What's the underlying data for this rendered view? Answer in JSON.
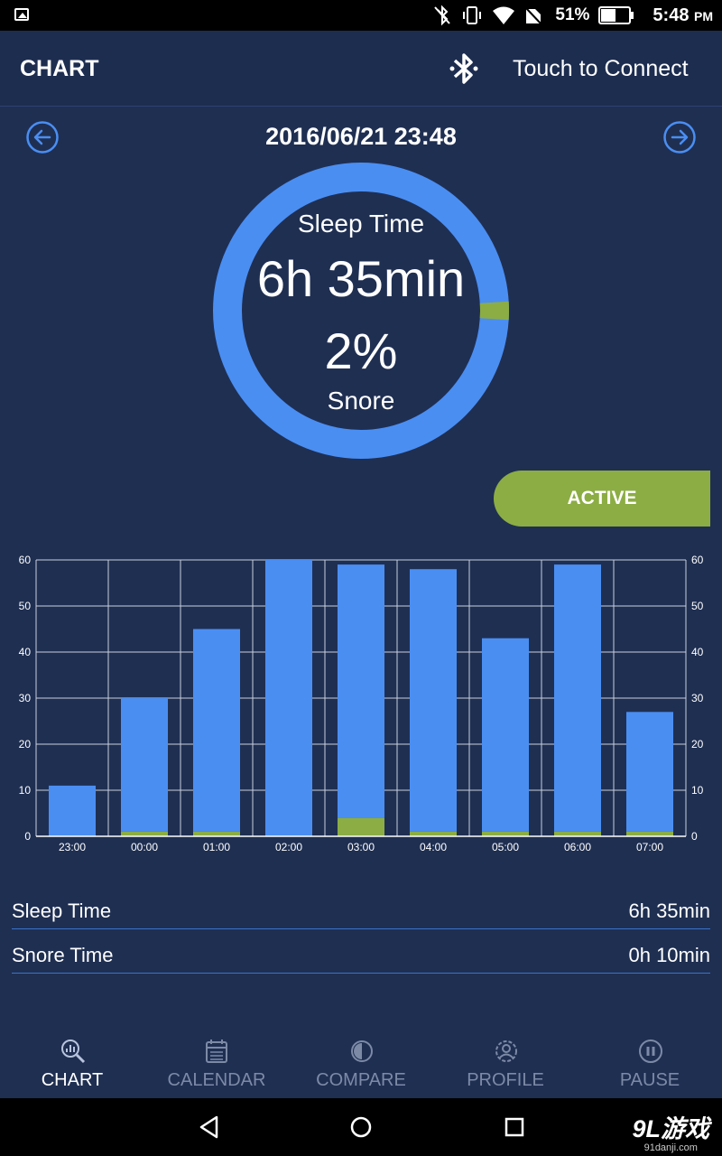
{
  "status_bar": {
    "battery_percent": "51%",
    "time": "5:48",
    "time_suffix": "PM",
    "icons": [
      "gallery-icon",
      "bluetooth-off-icon",
      "vibrate-icon",
      "wifi-icon",
      "no-sim-icon",
      "battery-icon"
    ]
  },
  "header": {
    "title": "CHART",
    "connect_label": "Touch to Connect",
    "icon": "bluetooth-icon"
  },
  "date_nav": {
    "date": "2016/06/21 23:48",
    "prev_icon": "arrow-left-circle-icon",
    "next_icon": "arrow-right-circle-icon"
  },
  "donut": {
    "label_top": "Sleep Time",
    "duration": "6h 35min",
    "snore_percent_label": "2%",
    "label_bottom": "Snore",
    "snore_fraction": 0.02,
    "colors": {
      "sleep": "#4a8ef2",
      "snore": "#8cad44"
    }
  },
  "active_button": {
    "label": "ACTIVE",
    "color": "#8cad44"
  },
  "chart_data": {
    "type": "bar",
    "stacked": true,
    "categories": [
      "23:00",
      "00:00",
      "01:00",
      "02:00",
      "03:00",
      "04:00",
      "05:00",
      "06:00",
      "07:00"
    ],
    "series": [
      {
        "color": "#4a8ef2",
        "values": [
          11,
          29,
          44,
          60,
          55,
          57,
          42,
          58,
          26
        ]
      },
      {
        "color": "#8cad44",
        "values": [
          0,
          1,
          1,
          0,
          4,
          1,
          1,
          1,
          1
        ]
      }
    ],
    "ylim": [
      0,
      60
    ],
    "yticks": [
      0,
      10,
      20,
      30,
      40,
      50,
      60
    ],
    "grid": true,
    "dual_y_axis": true
  },
  "summary": [
    {
      "label": "Sleep Time",
      "value": "6h 35min"
    },
    {
      "label": "Snore Time",
      "value": "0h 10min"
    }
  ],
  "bottom_nav": [
    {
      "label": "CHART",
      "icon": "chart-search-icon",
      "active": true
    },
    {
      "label": "CALENDAR",
      "icon": "calendar-icon",
      "active": false
    },
    {
      "label": "COMPARE",
      "icon": "compare-icon",
      "active": false
    },
    {
      "label": "PROFILE",
      "icon": "profile-icon",
      "active": false
    },
    {
      "label": "PAUSE",
      "icon": "pause-icon",
      "active": false
    }
  ],
  "system_nav": [
    "back-icon",
    "home-icon",
    "recents-icon"
  ],
  "watermark": {
    "main": "9L游戏",
    "sub": "91danji.com"
  }
}
